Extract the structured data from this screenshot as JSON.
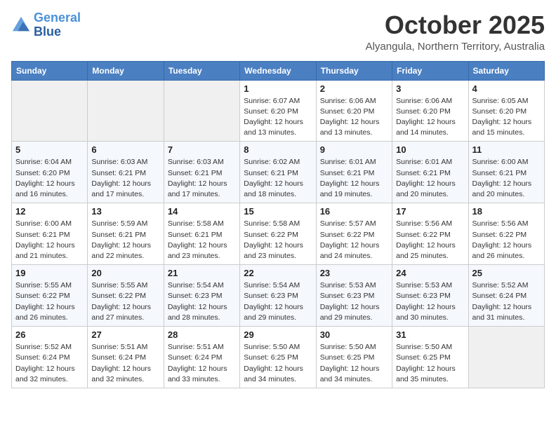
{
  "header": {
    "logo_line1": "General",
    "logo_line2": "Blue",
    "month_title": "October 2025",
    "subtitle": "Alyangula, Northern Territory, Australia"
  },
  "days_of_week": [
    "Sunday",
    "Monday",
    "Tuesday",
    "Wednesday",
    "Thursday",
    "Friday",
    "Saturday"
  ],
  "weeks": [
    [
      {
        "num": "",
        "info": ""
      },
      {
        "num": "",
        "info": ""
      },
      {
        "num": "",
        "info": ""
      },
      {
        "num": "1",
        "info": "Sunrise: 6:07 AM\nSunset: 6:20 PM\nDaylight: 12 hours\nand 13 minutes."
      },
      {
        "num": "2",
        "info": "Sunrise: 6:06 AM\nSunset: 6:20 PM\nDaylight: 12 hours\nand 13 minutes."
      },
      {
        "num": "3",
        "info": "Sunrise: 6:06 AM\nSunset: 6:20 PM\nDaylight: 12 hours\nand 14 minutes."
      },
      {
        "num": "4",
        "info": "Sunrise: 6:05 AM\nSunset: 6:20 PM\nDaylight: 12 hours\nand 15 minutes."
      }
    ],
    [
      {
        "num": "5",
        "info": "Sunrise: 6:04 AM\nSunset: 6:20 PM\nDaylight: 12 hours\nand 16 minutes."
      },
      {
        "num": "6",
        "info": "Sunrise: 6:03 AM\nSunset: 6:21 PM\nDaylight: 12 hours\nand 17 minutes."
      },
      {
        "num": "7",
        "info": "Sunrise: 6:03 AM\nSunset: 6:21 PM\nDaylight: 12 hours\nand 17 minutes."
      },
      {
        "num": "8",
        "info": "Sunrise: 6:02 AM\nSunset: 6:21 PM\nDaylight: 12 hours\nand 18 minutes."
      },
      {
        "num": "9",
        "info": "Sunrise: 6:01 AM\nSunset: 6:21 PM\nDaylight: 12 hours\nand 19 minutes."
      },
      {
        "num": "10",
        "info": "Sunrise: 6:01 AM\nSunset: 6:21 PM\nDaylight: 12 hours\nand 20 minutes."
      },
      {
        "num": "11",
        "info": "Sunrise: 6:00 AM\nSunset: 6:21 PM\nDaylight: 12 hours\nand 20 minutes."
      }
    ],
    [
      {
        "num": "12",
        "info": "Sunrise: 6:00 AM\nSunset: 6:21 PM\nDaylight: 12 hours\nand 21 minutes."
      },
      {
        "num": "13",
        "info": "Sunrise: 5:59 AM\nSunset: 6:21 PM\nDaylight: 12 hours\nand 22 minutes."
      },
      {
        "num": "14",
        "info": "Sunrise: 5:58 AM\nSunset: 6:21 PM\nDaylight: 12 hours\nand 23 minutes."
      },
      {
        "num": "15",
        "info": "Sunrise: 5:58 AM\nSunset: 6:22 PM\nDaylight: 12 hours\nand 23 minutes."
      },
      {
        "num": "16",
        "info": "Sunrise: 5:57 AM\nSunset: 6:22 PM\nDaylight: 12 hours\nand 24 minutes."
      },
      {
        "num": "17",
        "info": "Sunrise: 5:56 AM\nSunset: 6:22 PM\nDaylight: 12 hours\nand 25 minutes."
      },
      {
        "num": "18",
        "info": "Sunrise: 5:56 AM\nSunset: 6:22 PM\nDaylight: 12 hours\nand 26 minutes."
      }
    ],
    [
      {
        "num": "19",
        "info": "Sunrise: 5:55 AM\nSunset: 6:22 PM\nDaylight: 12 hours\nand 26 minutes."
      },
      {
        "num": "20",
        "info": "Sunrise: 5:55 AM\nSunset: 6:22 PM\nDaylight: 12 hours\nand 27 minutes."
      },
      {
        "num": "21",
        "info": "Sunrise: 5:54 AM\nSunset: 6:23 PM\nDaylight: 12 hours\nand 28 minutes."
      },
      {
        "num": "22",
        "info": "Sunrise: 5:54 AM\nSunset: 6:23 PM\nDaylight: 12 hours\nand 29 minutes."
      },
      {
        "num": "23",
        "info": "Sunrise: 5:53 AM\nSunset: 6:23 PM\nDaylight: 12 hours\nand 29 minutes."
      },
      {
        "num": "24",
        "info": "Sunrise: 5:53 AM\nSunset: 6:23 PM\nDaylight: 12 hours\nand 30 minutes."
      },
      {
        "num": "25",
        "info": "Sunrise: 5:52 AM\nSunset: 6:24 PM\nDaylight: 12 hours\nand 31 minutes."
      }
    ],
    [
      {
        "num": "26",
        "info": "Sunrise: 5:52 AM\nSunset: 6:24 PM\nDaylight: 12 hours\nand 32 minutes."
      },
      {
        "num": "27",
        "info": "Sunrise: 5:51 AM\nSunset: 6:24 PM\nDaylight: 12 hours\nand 32 minutes."
      },
      {
        "num": "28",
        "info": "Sunrise: 5:51 AM\nSunset: 6:24 PM\nDaylight: 12 hours\nand 33 minutes."
      },
      {
        "num": "29",
        "info": "Sunrise: 5:50 AM\nSunset: 6:25 PM\nDaylight: 12 hours\nand 34 minutes."
      },
      {
        "num": "30",
        "info": "Sunrise: 5:50 AM\nSunset: 6:25 PM\nDaylight: 12 hours\nand 34 minutes."
      },
      {
        "num": "31",
        "info": "Sunrise: 5:50 AM\nSunset: 6:25 PM\nDaylight: 12 hours\nand 35 minutes."
      },
      {
        "num": "",
        "info": ""
      }
    ]
  ]
}
